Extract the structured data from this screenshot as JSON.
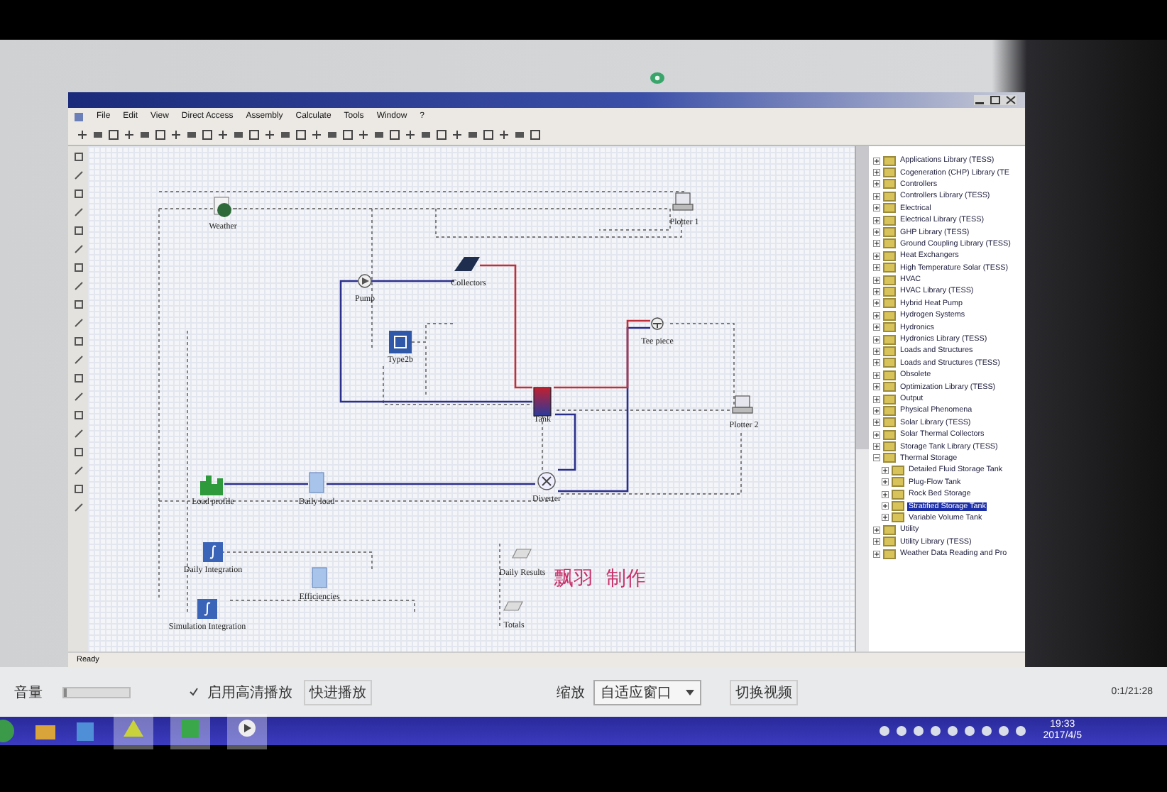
{
  "menu": [
    "File",
    "Edit",
    "View",
    "Direct Access",
    "Assembly",
    "Calculate",
    "Tools",
    "Window",
    "?"
  ],
  "diagram": {
    "components": [
      {
        "label": "Weather",
        "kind": "weather"
      },
      {
        "label": "Plotter 1",
        "kind": "plotter"
      },
      {
        "label": "Pump",
        "kind": "pump"
      },
      {
        "label": "Collectors",
        "kind": "collector"
      },
      {
        "label": "Type2b",
        "kind": "controller"
      },
      {
        "label": "Tee piece",
        "kind": "tee"
      },
      {
        "label": "Tank",
        "kind": "tank"
      },
      {
        "label": "Plotter 2",
        "kind": "plotter"
      },
      {
        "label": "Load profile",
        "kind": "profile"
      },
      {
        "label": "Daily load",
        "kind": "document"
      },
      {
        "label": "Diverter",
        "kind": "diverter"
      },
      {
        "label": "Daily Integration",
        "kind": "integrator"
      },
      {
        "label": "Efficiencies",
        "kind": "document"
      },
      {
        "label": "Daily Results",
        "kind": "printer"
      },
      {
        "label": "Totals",
        "kind": "printer"
      },
      {
        "label": "Simulation Integration",
        "kind": "integrator"
      }
    ],
    "overlay_caption": "飘羽  制作"
  },
  "library_tree": [
    {
      "label": "Applications Library (TESS)",
      "expanded": false,
      "selected": false
    },
    {
      "label": "Cogeneration (CHP) Library (TE",
      "expanded": false,
      "selected": false
    },
    {
      "label": "Controllers",
      "expanded": false,
      "selected": false
    },
    {
      "label": "Controllers Library (TESS)",
      "expanded": false,
      "selected": false
    },
    {
      "label": "Electrical",
      "expanded": false,
      "selected": false
    },
    {
      "label": "Electrical Library (TESS)",
      "expanded": false,
      "selected": false
    },
    {
      "label": "GHP Library (TESS)",
      "expanded": false,
      "selected": false
    },
    {
      "label": "Ground Coupling Library (TESS)",
      "expanded": false,
      "selected": false
    },
    {
      "label": "Heat Exchangers",
      "expanded": false,
      "selected": false
    },
    {
      "label": "High Temperature Solar (TESS)",
      "expanded": false,
      "selected": false
    },
    {
      "label": "HVAC",
      "expanded": false,
      "selected": false
    },
    {
      "label": "HVAC Library (TESS)",
      "expanded": false,
      "selected": false
    },
    {
      "label": "Hybrid Heat Pump",
      "expanded": false,
      "selected": false
    },
    {
      "label": "Hydrogen Systems",
      "expanded": false,
      "selected": false
    },
    {
      "label": "Hydronics",
      "expanded": false,
      "selected": false
    },
    {
      "label": "Hydronics Library (TESS)",
      "expanded": false,
      "selected": false
    },
    {
      "label": "Loads and Structures",
      "expanded": false,
      "selected": false
    },
    {
      "label": "Loads and Structures (TESS)",
      "expanded": false,
      "selected": false
    },
    {
      "label": "Obsolete",
      "expanded": false,
      "selected": false
    },
    {
      "label": "Optimization Library (TESS)",
      "expanded": false,
      "selected": false
    },
    {
      "label": "Output",
      "expanded": false,
      "selected": false
    },
    {
      "label": "Physical Phenomena",
      "expanded": false,
      "selected": false
    },
    {
      "label": "Solar Library (TESS)",
      "expanded": false,
      "selected": false
    },
    {
      "label": "Solar Thermal Collectors",
      "expanded": false,
      "selected": false
    },
    {
      "label": "Storage Tank Library (TESS)",
      "expanded": false,
      "selected": false
    },
    {
      "label": "Thermal Storage",
      "expanded": true,
      "selected": false,
      "children": [
        {
          "label": "Detailed Fluid Storage Tank",
          "expanded": false,
          "selected": false
        },
        {
          "label": "Plug-Flow Tank",
          "expanded": false,
          "selected": false
        },
        {
          "label": "Rock Bed Storage",
          "expanded": false,
          "selected": false
        },
        {
          "label": "Stratified Storage Tank",
          "expanded": false,
          "selected": true
        },
        {
          "label": "Variable Volume Tank",
          "expanded": false,
          "selected": false
        }
      ]
    },
    {
      "label": "Utility",
      "expanded": false,
      "selected": false
    },
    {
      "label": "Utility Library (TESS)",
      "expanded": false,
      "selected": false
    },
    {
      "label": "Weather Data Reading and Pro",
      "expanded": false,
      "selected": false
    }
  ],
  "status_bar": "Ready",
  "player": {
    "volume_label": "音量",
    "volume": {
      "level": 0.05
    },
    "hd": {
      "label": "启用高清播放",
      "checked": true
    },
    "fast_forward": "快进播放",
    "zoom_label": "缩放",
    "zoom_value": "自适应窗口",
    "switch_video": "切换视频",
    "time": "0:1/21:28"
  },
  "taskbar": {
    "time": "19:33",
    "date": "2017/4/5"
  }
}
